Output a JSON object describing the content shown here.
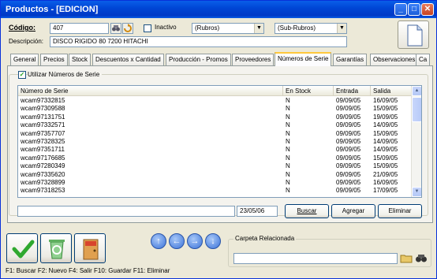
{
  "window": {
    "title": "Productos - [EDICION]",
    "minimize": "_",
    "maximize": "□",
    "close": "✕"
  },
  "header": {
    "codigo_label": "Código:",
    "codigo_value": "407",
    "inactivo_label": "Inactivo",
    "rubros_value": "(Rubros)",
    "subrubros_value": "(Sub-Rubros)",
    "descripcion_label": "Descripción:",
    "descripcion_value": "DISCO RIGIDO 80 7200  HITACHI"
  },
  "tabs": [
    {
      "label": "General"
    },
    {
      "label": "Precios"
    },
    {
      "label": "Stock"
    },
    {
      "label": "Descuentos x Cantidad"
    },
    {
      "label": "Producción - Promos"
    },
    {
      "label": "Proveedores"
    },
    {
      "label": "Números de Serie"
    },
    {
      "label": "Garantías"
    },
    {
      "label": "Observaciones"
    },
    {
      "label": "Ca"
    }
  ],
  "serials": {
    "use_label": "Utilizar Números de Serie",
    "use_checked": "✓",
    "columns": [
      "Número de Serie",
      "En Stock",
      "Entrada",
      "Salida"
    ],
    "rows": [
      [
        "wcam97332815",
        "N",
        "09/09/05",
        "16/09/05"
      ],
      [
        "wcam97309588",
        "N",
        "09/09/05",
        "15/09/05"
      ],
      [
        "wcam97131751",
        "N",
        "09/09/05",
        "19/09/05"
      ],
      [
        "wcam97332571",
        "N",
        "09/09/05",
        "14/09/05"
      ],
      [
        "wcam97357707",
        "N",
        "09/09/05",
        "15/09/05"
      ],
      [
        "wcam97328325",
        "N",
        "09/09/05",
        "14/09/05"
      ],
      [
        "wcam97351711",
        "N",
        "09/09/05",
        "14/09/05"
      ],
      [
        "wcam97176685",
        "N",
        "09/09/05",
        "15/09/05"
      ],
      [
        "wcam97280349",
        "N",
        "09/09/05",
        "15/09/05"
      ],
      [
        "wcam97335620",
        "N",
        "09/09/05",
        "21/09/05"
      ],
      [
        "wcam97328899",
        "N",
        "09/09/05",
        "16/09/05"
      ],
      [
        "wcam97318253",
        "N",
        "09/09/05",
        "17/09/05"
      ]
    ],
    "date_value": "23/05/06",
    "buscar": "Buscar",
    "agregar": "Agregar",
    "eliminar": "Eliminar"
  },
  "carpeta": {
    "label": "Carpeta Relacionada"
  },
  "status": "F1: Buscar  F2: Nuevo  F4: Salir  F10: Guardar  F11: Eliminar",
  "icons": [
    "document-icon",
    "binoculars-icon",
    "refresh-icon",
    "save-check-icon",
    "recycle-bin-icon",
    "exit-door-icon",
    "arrow-up-icon",
    "arrow-left-icon",
    "arrow-right-icon",
    "arrow-down-icon",
    "folder-icon"
  ],
  "colors": {
    "title_bar": "#0047d6",
    "accent_tab": "#ffc83c",
    "save_green": "#2fa82f",
    "exit_red": "#d8452c"
  }
}
